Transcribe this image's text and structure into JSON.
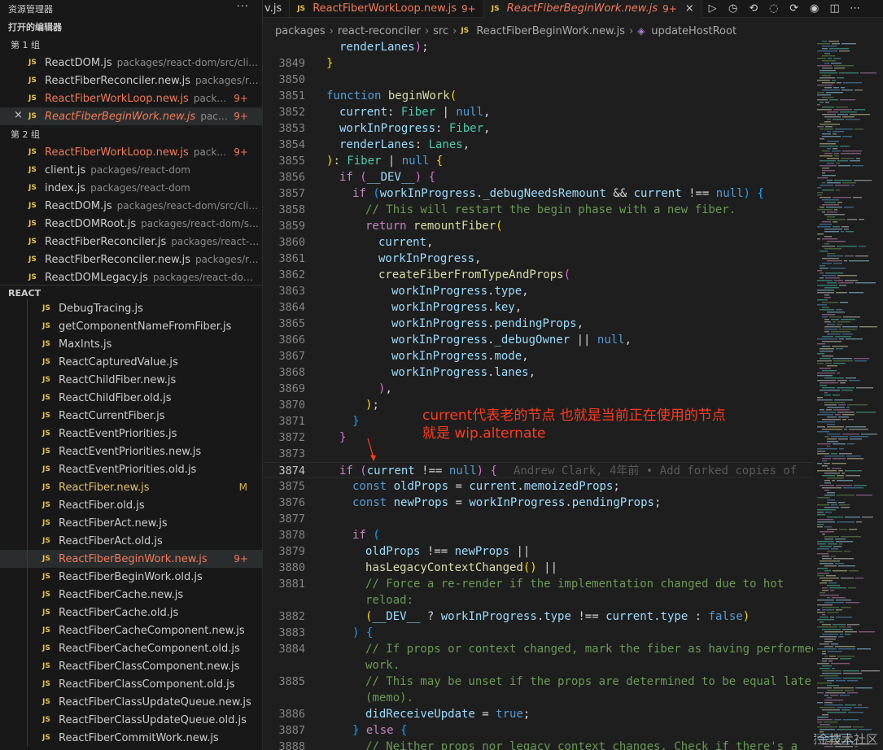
{
  "sidebar": {
    "title": "资源管理器",
    "more_label": "···",
    "open_editors_title": "打开的编辑器",
    "groups": [
      {
        "title": "第 1 组",
        "items": [
          {
            "name": "ReactDOM.js",
            "path": "packages/react-dom/src/client",
            "badge": "",
            "modified": false,
            "italic": false,
            "active": false
          },
          {
            "name": "ReactFiberReconciler.new.js",
            "path": "packages/reac...",
            "badge": "",
            "modified": false,
            "italic": false,
            "active": false
          },
          {
            "name": "ReactFiberWorkLoop.new.js",
            "path": "packag...",
            "badge": "9+",
            "modified": true,
            "italic": false,
            "active": false
          },
          {
            "name": "ReactFiberBeginWork.new.js",
            "path": "packag...",
            "badge": "9+",
            "modified": true,
            "italic": true,
            "active": true
          }
        ]
      },
      {
        "title": "第 2 组",
        "items": [
          {
            "name": "ReactFiberWorkLoop.new.js",
            "path": "packag...",
            "badge": "9+",
            "modified": true,
            "italic": false,
            "active": false
          },
          {
            "name": "client.js",
            "path": "packages/react-dom",
            "badge": "",
            "modified": false,
            "italic": false,
            "active": false
          },
          {
            "name": "index.js",
            "path": "packages/react-dom",
            "badge": "",
            "modified": false,
            "italic": false,
            "active": false
          },
          {
            "name": "ReactDOM.js",
            "path": "packages/react-dom/src/client",
            "badge": "",
            "modified": false,
            "italic": false,
            "active": false
          },
          {
            "name": "ReactDOMRoot.js",
            "path": "packages/react-dom/src/...",
            "badge": "",
            "modified": false,
            "italic": false,
            "active": false
          },
          {
            "name": "ReactFiberReconciler.js",
            "path": "packages/react-rec...",
            "badge": "",
            "modified": false,
            "italic": false,
            "active": false
          },
          {
            "name": "ReactFiberReconciler.new.js",
            "path": "packages/reac...",
            "badge": "",
            "modified": false,
            "italic": false,
            "active": false
          },
          {
            "name": "ReactDOMLegacy.js",
            "path": "packages/react-dom/sr...",
            "badge": "",
            "modified": false,
            "italic": false,
            "active": false
          }
        ]
      }
    ],
    "react_section_title": "REACT",
    "tree": [
      {
        "name": "DebugTracing.js",
        "badge": "",
        "state": ""
      },
      {
        "name": "getComponentNameFromFiber.js",
        "badge": "",
        "state": ""
      },
      {
        "name": "MaxInts.js",
        "badge": "",
        "state": ""
      },
      {
        "name": "ReactCapturedValue.js",
        "badge": "",
        "state": ""
      },
      {
        "name": "ReactChildFiber.new.js",
        "badge": "",
        "state": ""
      },
      {
        "name": "ReactChildFiber.old.js",
        "badge": "",
        "state": ""
      },
      {
        "name": "ReactCurrentFiber.js",
        "badge": "",
        "state": ""
      },
      {
        "name": "ReactEventPriorities.js",
        "badge": "",
        "state": ""
      },
      {
        "name": "ReactEventPriorities.new.js",
        "badge": "",
        "state": ""
      },
      {
        "name": "ReactEventPriorities.old.js",
        "badge": "",
        "state": ""
      },
      {
        "name": "ReactFiber.new.js",
        "badge": "M",
        "state": "mod-y"
      },
      {
        "name": "ReactFiber.old.js",
        "badge": "",
        "state": ""
      },
      {
        "name": "ReactFiberAct.new.js",
        "badge": "",
        "state": ""
      },
      {
        "name": "ReactFiberAct.old.js",
        "badge": "",
        "state": ""
      },
      {
        "name": "ReactFiberBeginWork.new.js",
        "badge": "9+",
        "state": "mod-r active"
      },
      {
        "name": "ReactFiberBeginWork.old.js",
        "badge": "",
        "state": ""
      },
      {
        "name": "ReactFiberCache.new.js",
        "badge": "",
        "state": ""
      },
      {
        "name": "ReactFiberCache.old.js",
        "badge": "",
        "state": ""
      },
      {
        "name": "ReactFiberCacheComponent.new.js",
        "badge": "",
        "state": ""
      },
      {
        "name": "ReactFiberCacheComponent.old.js",
        "badge": "",
        "state": ""
      },
      {
        "name": "ReactFiberClassComponent.new.js",
        "badge": "",
        "state": ""
      },
      {
        "name": "ReactFiberClassComponent.old.js",
        "badge": "",
        "state": ""
      },
      {
        "name": "ReactFiberClassUpdateQueue.new.js",
        "badge": "",
        "state": ""
      },
      {
        "name": "ReactFiberClassUpdateQueue.old.js",
        "badge": "",
        "state": ""
      },
      {
        "name": "ReactFiberCommitWork.new.js",
        "badge": "",
        "state": ""
      }
    ]
  },
  "tabs": [
    {
      "label": "v.js",
      "count": "",
      "italic": false,
      "active": false,
      "partial": true
    },
    {
      "label": "ReactFiberWorkLoop.new.js",
      "count": "9+",
      "italic": false,
      "active": false,
      "partial": false
    },
    {
      "label": "ReactFiberBeginWork.new.js",
      "count": "9+",
      "italic": true,
      "active": true,
      "partial": false
    }
  ],
  "js_badge": "JS",
  "close_glyph": "×",
  "breadcrumbs": {
    "parts": [
      "packages",
      "react-reconciler",
      "src"
    ],
    "file": "ReactFiberBeginWork.new.js",
    "symbol": "updateHostRoot",
    "separator": "›"
  },
  "editor": {
    "current_line": "3874",
    "blame": "Andrew Clark, 4年前 • Add forked copies of",
    "annotation_line1": "current代表老的节点 也就是当前正在使用的节点",
    "annotation_line2": "就是 wip.alternate",
    "lines": [
      {
        "n": "",
        "html": "<span class='vr'>renderLanes</span><span class='br2'>)</span><span class='pn'>;</span>",
        "indent": 1
      },
      {
        "n": "3849",
        "html": "<span class='br1'>}</span>",
        "indent": 0
      },
      {
        "n": "3850",
        "html": "",
        "indent": 0
      },
      {
        "n": "3851",
        "html": "<span class='kw'>function</span> <span class='fn'>beginWork</span><span class='br1'>(</span>",
        "indent": 0
      },
      {
        "n": "3852",
        "html": "<span class='vr'>current</span><span class='pn'>: </span><span class='ty'>Fiber</span><span class='pn'> | </span><span class='kw'>null</span><span class='pn'>,</span>",
        "indent": 1
      },
      {
        "n": "3853",
        "html": "<span class='vr'>workInProgress</span><span class='pn'>: </span><span class='ty'>Fiber</span><span class='pn'>,</span>",
        "indent": 1
      },
      {
        "n": "3854",
        "html": "<span class='vr'>renderLanes</span><span class='pn'>: </span><span class='ty'>Lanes</span><span class='pn'>,</span>",
        "indent": 1
      },
      {
        "n": "3855",
        "html": "<span class='br1'>)</span><span class='pn'>: </span><span class='ty'>Fiber</span><span class='pn'> | </span><span class='kw'>null</span> <span class='br1'>{</span>",
        "indent": 0
      },
      {
        "n": "3856",
        "html": "<span class='ctl'>if</span> <span class='br2'>(</span><span class='vr'>__DEV__</span><span class='br2'>)</span> <span class='br2'>{</span>",
        "indent": 1
      },
      {
        "n": "3857",
        "html": "<span class='ctl'>if</span> <span class='br3'>(</span><span class='vr'>workInProgress</span><span class='pn'>.</span><span class='vr'>_debugNeedsRemount</span><span class='pn'> &amp;&amp; </span><span class='vr'>current</span><span class='pn'> !== </span><span class='kw'>null</span><span class='br3'>)</span> <span class='br3'>{</span>",
        "indent": 2
      },
      {
        "n": "3858",
        "html": "<span class='cm'>// This will restart the begin phase with a new fiber.</span>",
        "indent": 3
      },
      {
        "n": "3859",
        "html": "<span class='ctl'>return</span> <span class='fn'>remountFiber</span><span class='br1'>(</span>",
        "indent": 3
      },
      {
        "n": "3860",
        "html": "<span class='vr'>current</span><span class='pn'>,</span>",
        "indent": 4
      },
      {
        "n": "3861",
        "html": "<span class='vr'>workInProgress</span><span class='pn'>,</span>",
        "indent": 4
      },
      {
        "n": "3862",
        "html": "<span class='fn'>createFiberFromTypeAndProps</span><span class='br2'>(</span>",
        "indent": 4
      },
      {
        "n": "3863",
        "html": "<span class='vr'>workInProgress</span><span class='pn'>.</span><span class='vr'>type</span><span class='pn'>,</span>",
        "indent": 5
      },
      {
        "n": "3864",
        "html": "<span class='vr'>workInProgress</span><span class='pn'>.</span><span class='vr'>key</span><span class='pn'>,</span>",
        "indent": 5
      },
      {
        "n": "3865",
        "html": "<span class='vr'>workInProgress</span><span class='pn'>.</span><span class='vr'>pendingProps</span><span class='pn'>,</span>",
        "indent": 5
      },
      {
        "n": "3866",
        "html": "<span class='vr'>workInProgress</span><span class='pn'>.</span><span class='vr'>_debugOwner</span><span class='pn'> || </span><span class='kw'>null</span><span class='pn'>,</span>",
        "indent": 5
      },
      {
        "n": "3867",
        "html": "<span class='vr'>workInProgress</span><span class='pn'>.</span><span class='vr'>mode</span><span class='pn'>,</span>",
        "indent": 5
      },
      {
        "n": "3868",
        "html": "<span class='vr'>workInProgress</span><span class='pn'>.</span><span class='vr'>lanes</span><span class='pn'>,</span>",
        "indent": 5
      },
      {
        "n": "3869",
        "html": "<span class='br2'>)</span><span class='pn'>,</span>",
        "indent": 4
      },
      {
        "n": "3870",
        "html": "<span class='br1'>)</span><span class='pn'>;</span>",
        "indent": 3
      },
      {
        "n": "3871",
        "html": "<span class='br3'>}</span>",
        "indent": 2
      },
      {
        "n": "3872",
        "html": "<span class='br2'>}</span>",
        "indent": 1
      },
      {
        "n": "3873",
        "html": "",
        "indent": 0
      },
      {
        "n": "3874",
        "html": "<span class='ctl'>if</span> <span class='br2'>(</span><span class='vr'>current</span><span class='pn'> !== </span><span class='kw'>null</span><span class='br2'>)</span> <span class='br2'>{</span>",
        "indent": 1,
        "current": true
      },
      {
        "n": "3875",
        "html": "<span class='kw'>const</span> <span class='vr'>oldProps</span><span class='pn'> = </span><span class='vr'>current</span><span class='pn'>.</span><span class='vr'>memoizedProps</span><span class='pn'>;</span>",
        "indent": 2
      },
      {
        "n": "3876",
        "html": "<span class='kw'>const</span> <span class='vr'>newProps</span><span class='pn'> = </span><span class='vr'>workInProgress</span><span class='pn'>.</span><span class='vr'>pendingProps</span><span class='pn'>;</span>",
        "indent": 2
      },
      {
        "n": "3877",
        "html": "",
        "indent": 0
      },
      {
        "n": "3878",
        "html": "<span class='ctl'>if</span> <span class='br3'>(</span>",
        "indent": 2
      },
      {
        "n": "3879",
        "html": "<span class='vr'>oldProps</span><span class='pn'> !== </span><span class='vr'>newProps</span><span class='pn'> ||</span>",
        "indent": 3
      },
      {
        "n": "3880",
        "html": "<span class='fn'>hasLegacyContextChanged</span><span class='br1'>()</span><span class='pn'> ||</span>",
        "indent": 3
      },
      {
        "n": "3881",
        "html": "<span class='cm'>// Force a re-render if the implementation changed due to hot</span>",
        "indent": 3
      },
      {
        "n": "",
        "html": "<span class='cm'>reload:</span>",
        "indent": 3
      },
      {
        "n": "3882",
        "html": "<span class='br1'>(</span><span class='vr'>__DEV__</span><span class='pn'> ? </span><span class='vr'>workInProgress</span><span class='pn'>.</span><span class='vr'>type</span><span class='pn'> !== </span><span class='vr'>current</span><span class='pn'>.</span><span class='vr'>type</span><span class='pn'> : </span><span class='kw'>false</span><span class='br1'>)</span>",
        "indent": 3
      },
      {
        "n": "3883",
        "html": "<span class='br3'>)</span> <span class='br3'>{</span>",
        "indent": 2
      },
      {
        "n": "3884",
        "html": "<span class='cm'>// If props or context changed, mark the fiber as having performed</span>",
        "indent": 3
      },
      {
        "n": "",
        "html": "<span class='cm'>work.</span>",
        "indent": 3
      },
      {
        "n": "3885",
        "html": "<span class='cm'>// This may be unset if the props are determined to be equal later</span>",
        "indent": 3
      },
      {
        "n": "",
        "html": "<span class='cm'>(memo).</span>",
        "indent": 3
      },
      {
        "n": "3886",
        "html": "<span class='vr'>didReceiveUpdate</span><span class='pn'> = </span><span class='kw'>true</span><span class='pn'>;</span>",
        "indent": 3
      },
      {
        "n": "3887",
        "html": "<span class='br3'>}</span> <span class='ctl'>else</span> <span class='br3'>{</span>",
        "indent": 2
      },
      {
        "n": "3888",
        "html": "<span class='cm'>// Neither props nor legacy context changes. Check if there's a</span>",
        "indent": 3
      }
    ]
  },
  "watermark": "@稀土掘金技术社区",
  "colors": {
    "accent_modified": "#f07a5a",
    "js_icon": "#e8c44d",
    "annotation": "#ff3b1f"
  }
}
